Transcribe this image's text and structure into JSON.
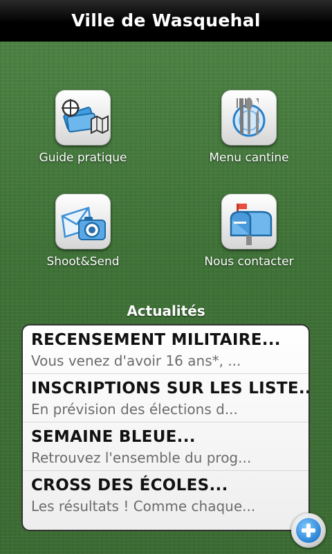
{
  "app": {
    "title": "Ville de Wasquehal"
  },
  "tiles": [
    {
      "label": "Guide pratique",
      "icon": "guide-map-icon"
    },
    {
      "label": "Menu cantine",
      "icon": "cutlery-icon"
    },
    {
      "label": "Shoot&Send",
      "icon": "camera-icon"
    },
    {
      "label": "Nous contacter",
      "icon": "mailbox-icon"
    }
  ],
  "news": {
    "heading": "Actualités",
    "items": [
      {
        "title": "RECENSEMENT MILITAIRE...",
        "summary": "Vous venez d'avoir 16 ans*, ..."
      },
      {
        "title": "INSCRIPTIONS SUR LES LISTE...",
        "summary": "En prévision des élections d..."
      },
      {
        "title": "SEMAINE BLEUE...",
        "summary": "Retrouvez l'ensemble du prog..."
      },
      {
        "title": "CROSS DES ÉCOLES...",
        "summary": "Les résultats ! Comme chaque..."
      }
    ]
  },
  "fab": {
    "icon": "plus-icon"
  }
}
